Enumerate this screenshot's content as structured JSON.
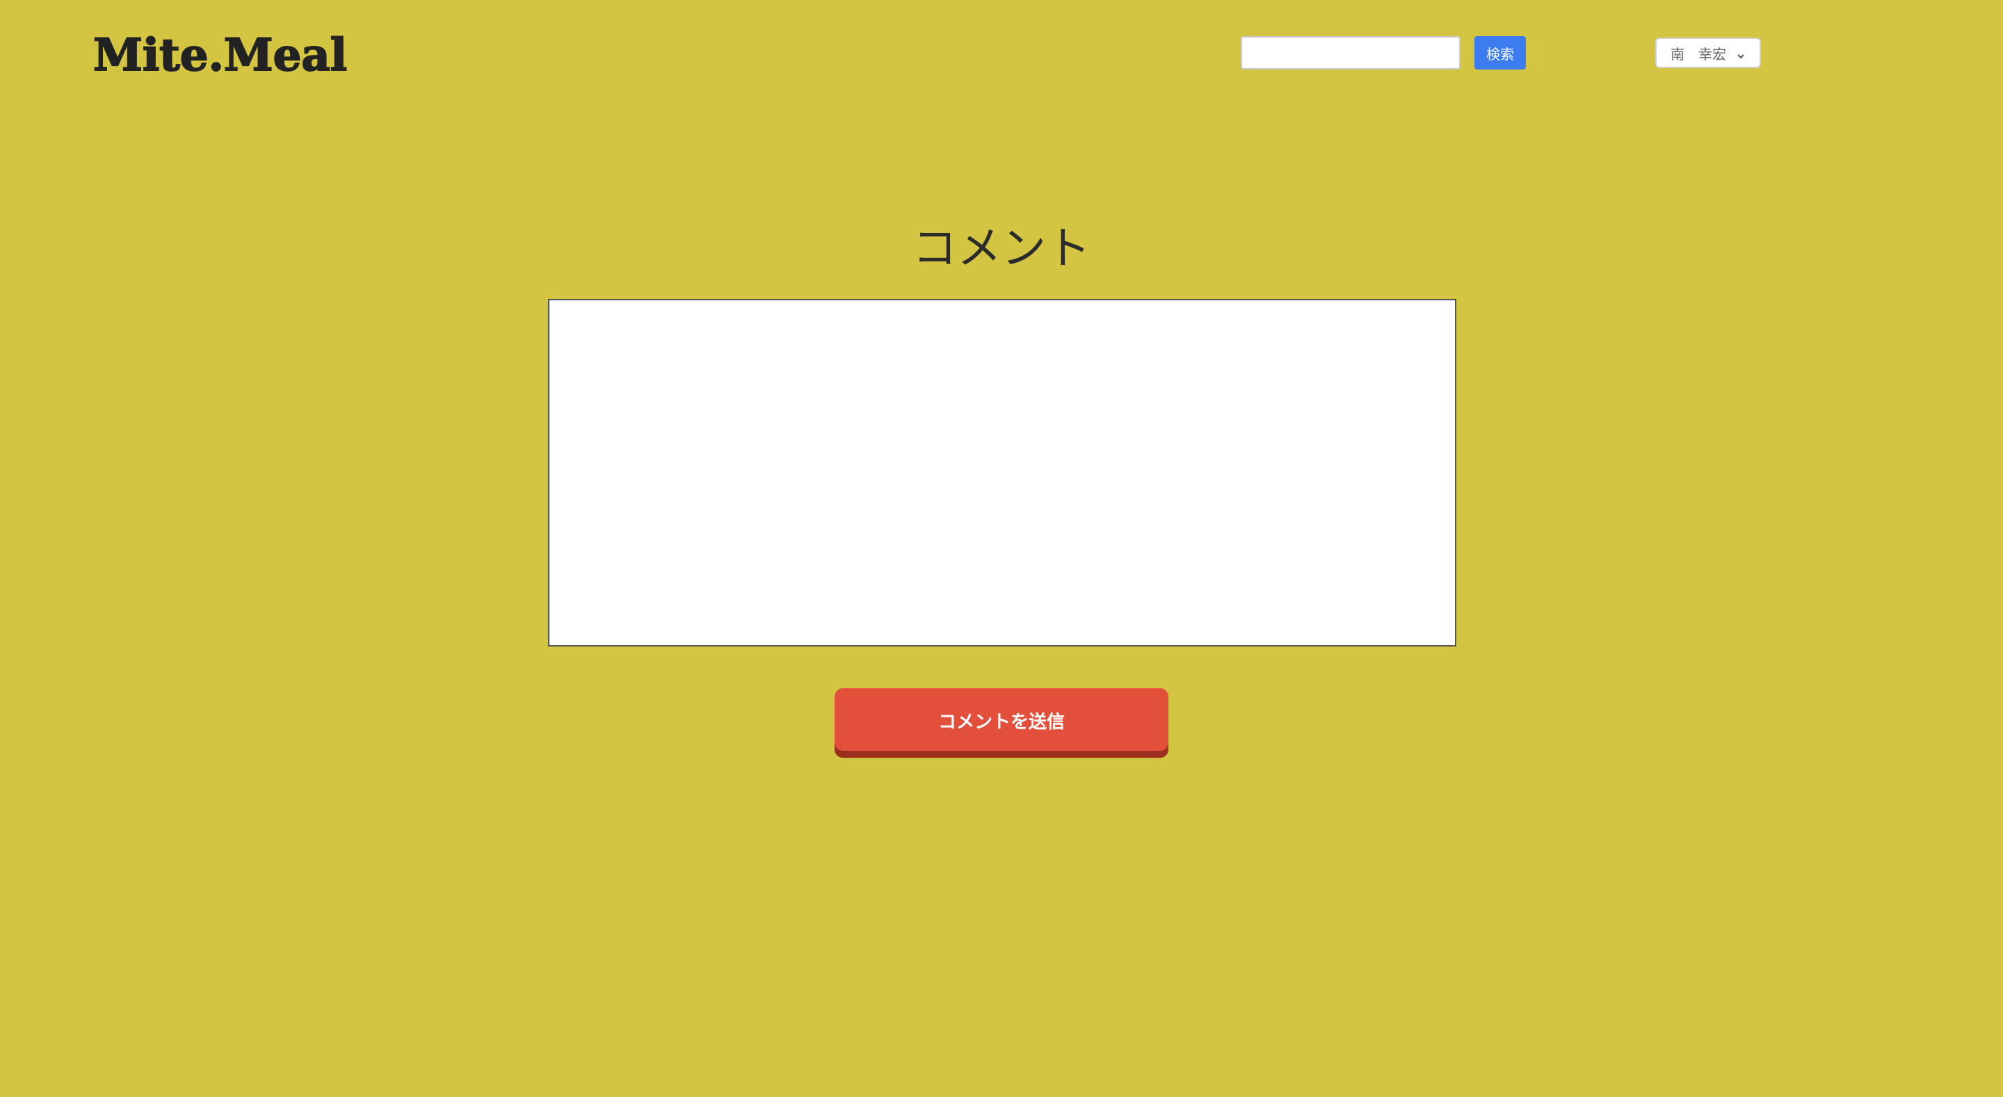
{
  "header": {
    "logo_text": "Mite.Meal",
    "search": {
      "placeholder": "",
      "value": "",
      "button_label": "検索"
    },
    "user_menu": {
      "name": "南　幸宏",
      "icon": "chevron-down-icon"
    }
  },
  "main": {
    "title": "コメント",
    "comment_field": {
      "placeholder": "",
      "value": ""
    },
    "submit_label": "コメントを送信"
  },
  "colors": {
    "background": "#d3c442",
    "search_button": "#3d7bf0",
    "submit_button": "#e2503c",
    "submit_button_shadow": "#9b2e1c"
  }
}
